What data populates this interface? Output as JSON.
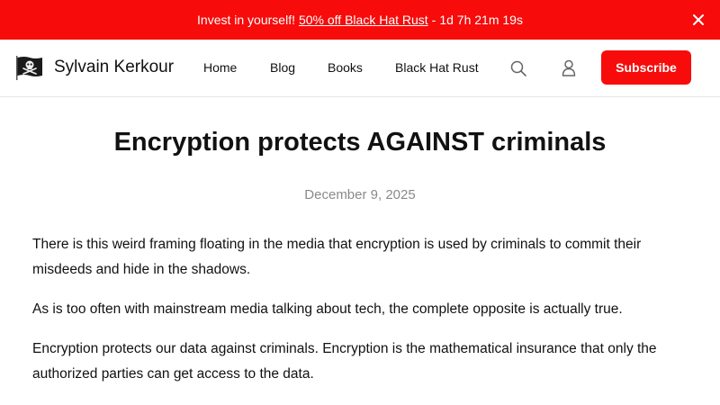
{
  "promo": {
    "text": "Invest in yourself!",
    "link_text": "50% off Black Hat Rust",
    "separator": "-",
    "countdown": "1d 7h 21m 19s",
    "close_icon": "close-icon"
  },
  "header": {
    "site_title": "Sylvain Kerkour",
    "logo_icon": "pirate-flag-icon",
    "nav": {
      "home": "Home",
      "blog": "Blog",
      "books": "Books",
      "black_hat_rust": "Black Hat Rust"
    },
    "search_icon": "search-icon",
    "account_icon": "account-icon",
    "subscribe_label": "Subscribe"
  },
  "article": {
    "title": "Encryption protects AGAINST criminals",
    "date": "December 9, 2025",
    "paragraphs": [
      "There is this weird framing floating in the media that encryption is used by criminals to commit their misdeeds and hide in the shadows.",
      "As is too often with mainstream media talking about tech, the complete opposite is actually true.",
      "Encryption protects our data against criminals. Encryption is the mathematical insurance that only the authorized parties can get access to the data."
    ]
  },
  "colors": {
    "accent": "#f70b0b",
    "date_gray": "#8a8a8a",
    "text": "#111111"
  }
}
